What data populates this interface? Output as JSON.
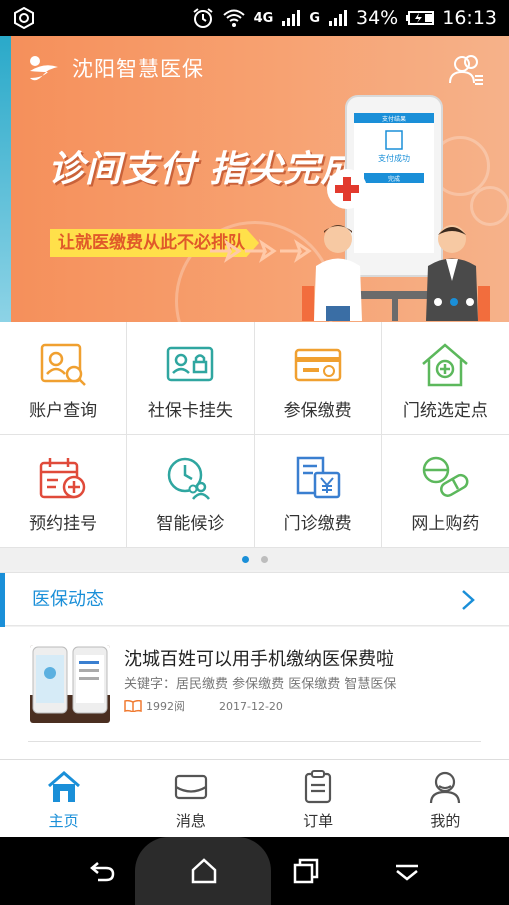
{
  "status_bar": {
    "network": "4G",
    "signal_label": "G",
    "battery": "34%",
    "time": "16:13"
  },
  "banner": {
    "app_name": "沈阳智慧医保",
    "headline": "诊间支付 指尖完成",
    "slogan": "让就医缴费从此不必排队",
    "phone_screen": {
      "title": "支付结果",
      "status": "支付成功",
      "button": "完成"
    },
    "active_slide": 2,
    "slide_count": 3
  },
  "services": [
    {
      "label": "账户查询",
      "icon": "account-query-icon"
    },
    {
      "label": "社保卡挂失",
      "icon": "card-loss-icon"
    },
    {
      "label": "参保缴费",
      "icon": "insurance-payment-icon"
    },
    {
      "label": "门统选定点",
      "icon": "clinic-select-icon"
    },
    {
      "label": "预约挂号",
      "icon": "appointment-icon"
    },
    {
      "label": "智能候诊",
      "icon": "smart-waiting-icon"
    },
    {
      "label": "门诊缴费",
      "icon": "outpatient-payment-icon"
    },
    {
      "label": "网上购药",
      "icon": "online-pharmacy-icon"
    }
  ],
  "news": {
    "section_title": "医保动态",
    "items": [
      {
        "title": "沈城百姓可以用手机缴纳医保费啦",
        "keywords": "关键字：居民缴费  参保缴费  医保缴费  智慧医保",
        "reads": "1992阅",
        "date": "2017-12-20"
      }
    ]
  },
  "tabs": [
    {
      "label": "主页",
      "icon": "home-icon",
      "active": true
    },
    {
      "label": "消息",
      "icon": "message-icon",
      "active": false
    },
    {
      "label": "订单",
      "icon": "order-icon",
      "active": false
    },
    {
      "label": "我的",
      "icon": "profile-icon",
      "active": false
    }
  ],
  "colors": {
    "accent": "#1a8fd8",
    "banner_orange": "#f7a06f",
    "slogan_yellow": "#ffe04a"
  }
}
